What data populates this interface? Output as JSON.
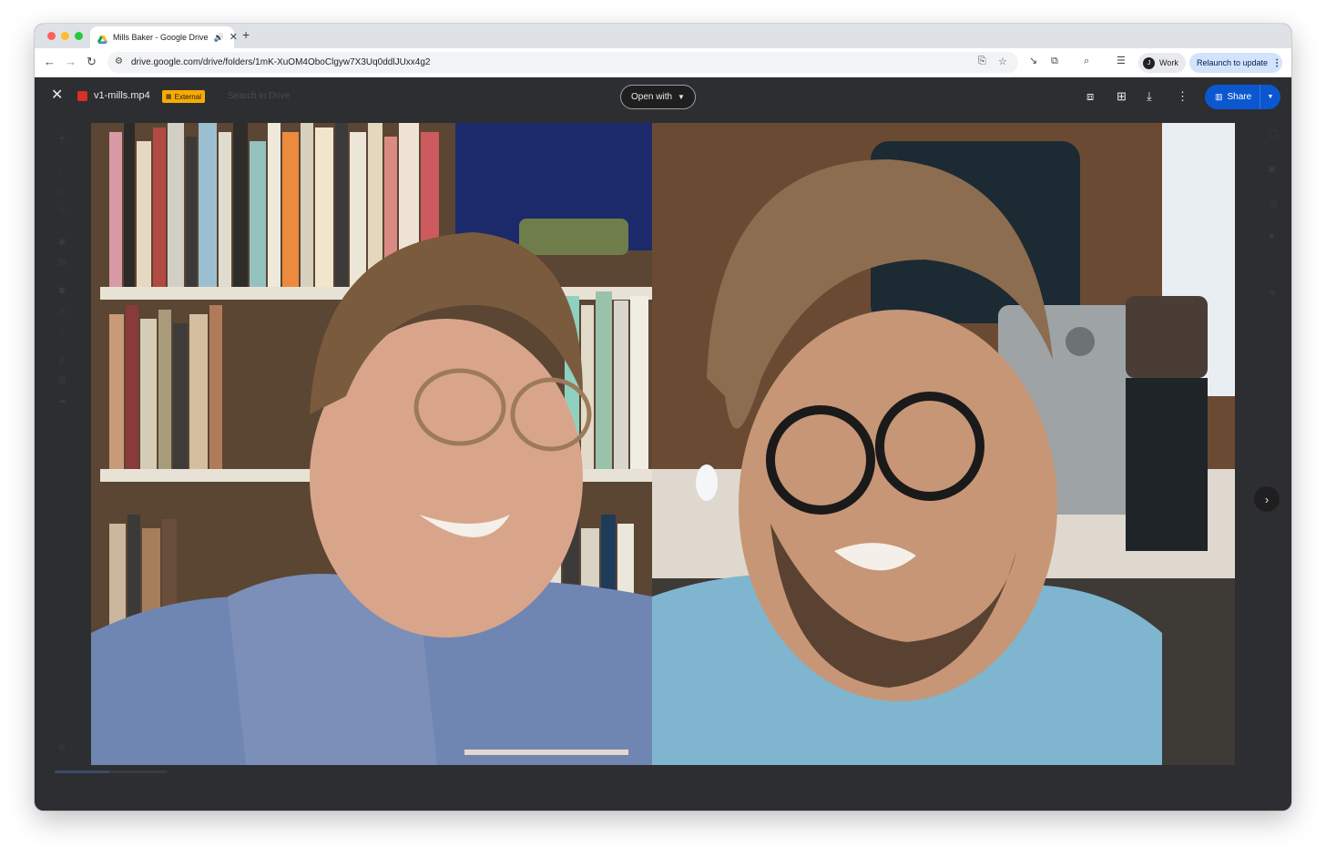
{
  "browser": {
    "tab": {
      "title": "Mills Baker - Google Drive",
      "audio_icon": "speaker-icon"
    },
    "url": "drive.google.com/drive/folders/1mK-XuOM4OboClgyw7X3Uq0ddlJUxx4g2",
    "profile_label": "Work",
    "profile_initial": "J",
    "relaunch_label": "Relaunch to update"
  },
  "viewer": {
    "file_name": "v1-mills.mp4",
    "external_label": "External",
    "open_with_label": "Open with",
    "share_label": "Share"
  },
  "colors": {
    "viewer_bg": "#2d2e31",
    "share_button": "#0b57d0",
    "external_badge": "#f9ab00",
    "relaunch_pill": "#d3e3fd"
  }
}
